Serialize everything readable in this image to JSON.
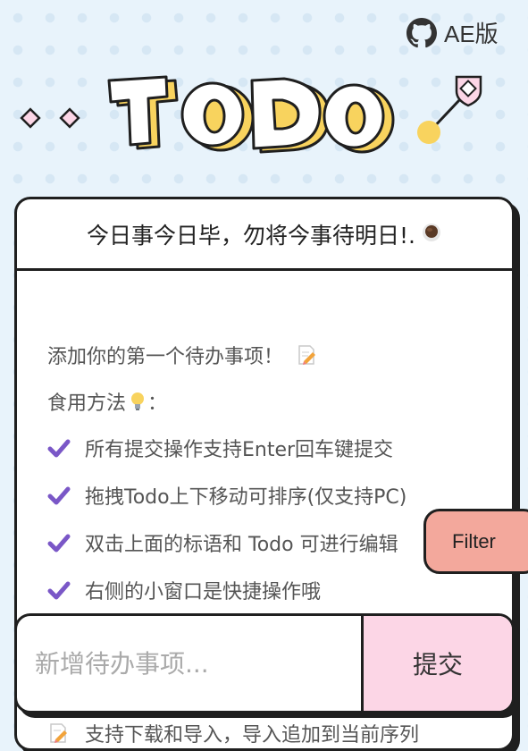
{
  "header": {
    "github_label": "AE版",
    "logo_text": "TODO"
  },
  "card": {
    "title": "今日事今日毕，勿将今事待明日!.",
    "title_emoji": "☕",
    "intro": "添加你的第一个待办事项！",
    "usage_label": "食用方法",
    "usage_suffix": "：",
    "tips": [
      "所有提交操作支持Enter回车键提交",
      "拖拽Todo上下移动可排序(仅支持PC)",
      "双击上面的标语和 Todo 可进行编辑",
      "右侧的小窗口是快捷操作哦"
    ],
    "extra_tip": "支持下载和导入，导入追加到当前序列"
  },
  "filter": {
    "label": "Filter"
  },
  "input": {
    "placeholder": "新增待办事项...",
    "value": ""
  },
  "submit": {
    "label": "提交"
  },
  "colors": {
    "background": "#e8f3fb",
    "logo_yellow": "#f8d35e",
    "check_purple": "#7a57c7",
    "filter_bg": "#f3a89c",
    "submit_bg": "#fcd6e6",
    "outline": "#1f1f1f"
  }
}
